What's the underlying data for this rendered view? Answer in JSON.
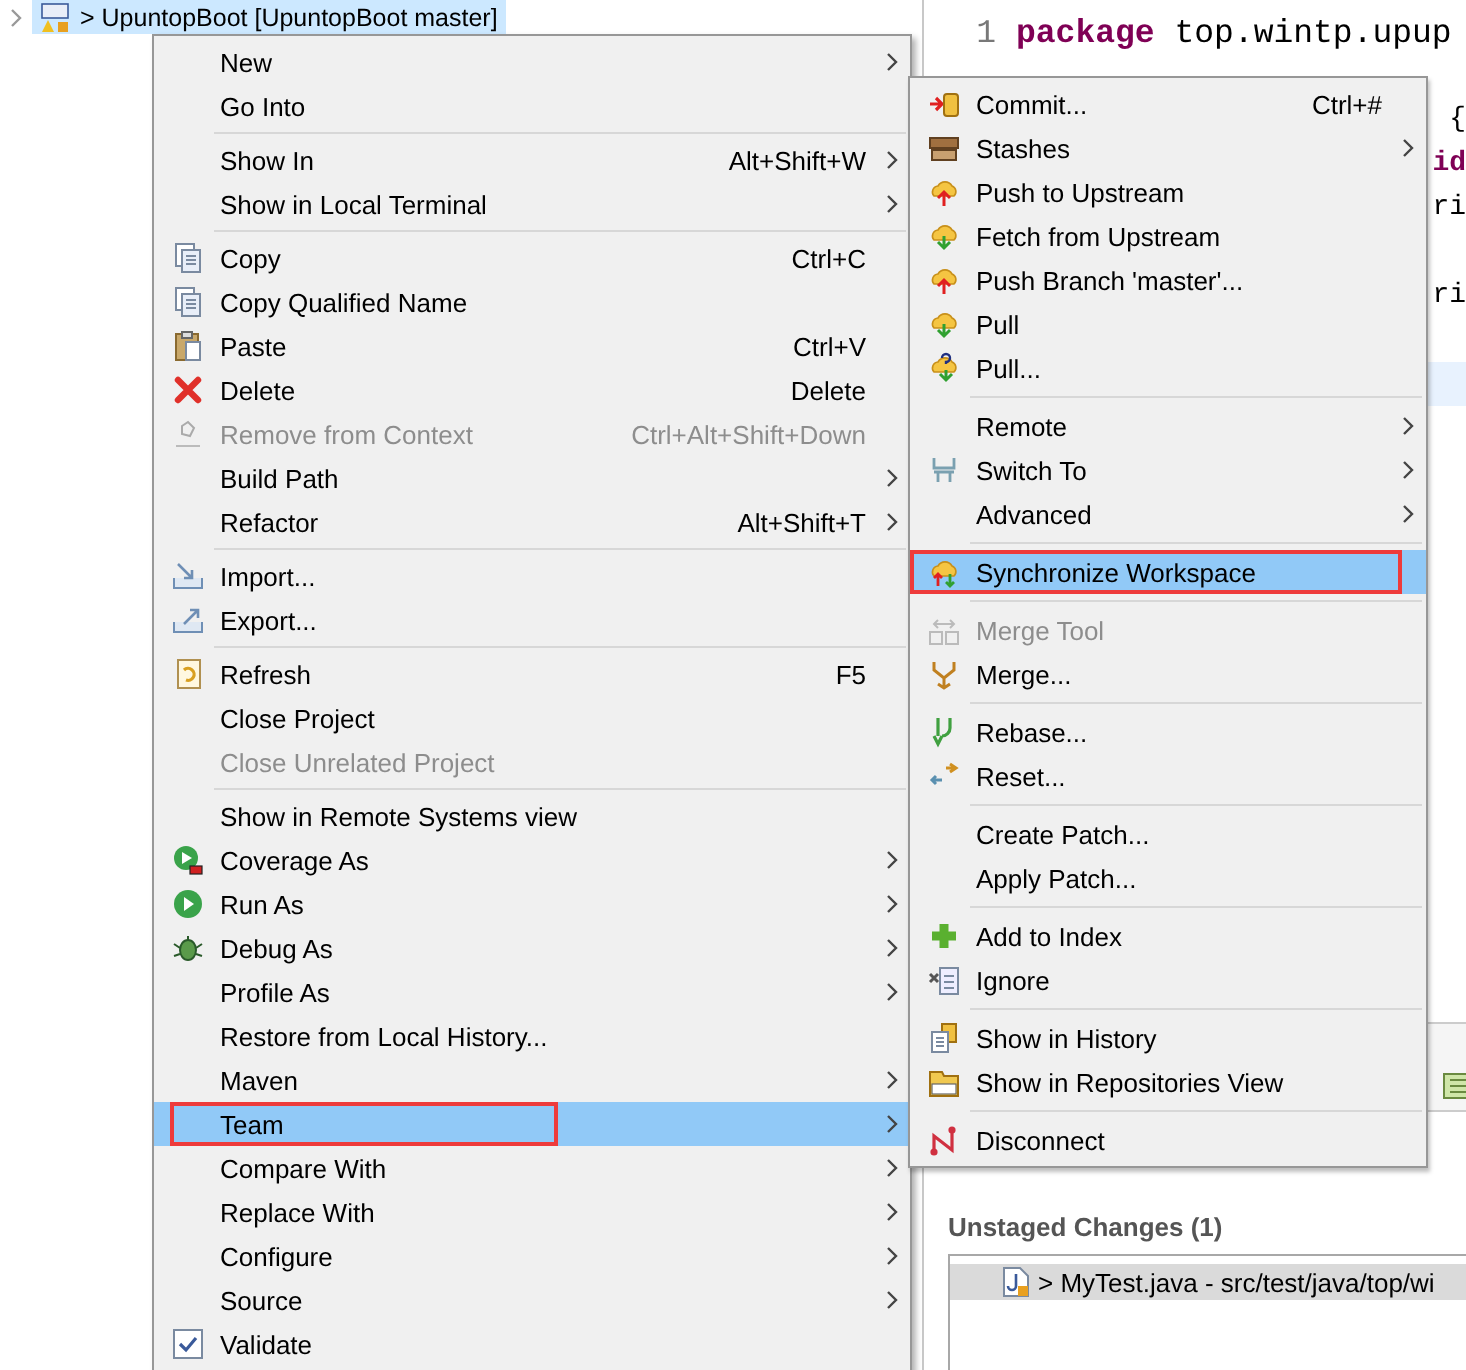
{
  "tree": {
    "label": "> UpuntopBoot [UpuntopBoot master]",
    "selected": true
  },
  "editor": {
    "lines": [
      {
        "number": "1",
        "text": "**package** top.wintp.upup",
        "kind": "full",
        "current": false
      },
      {
        "kind": "full",
        "current": false
      },
      {
        "text": "{",
        "kind": "fragment",
        "current": false
      },
      {
        "text": "id",
        "kind": "keyword",
        "current": false
      },
      {
        "text": "ri",
        "kind": "fragment",
        "current": false
      },
      {
        "kind": "fragment",
        "current": false
      },
      {
        "text": "ri",
        "kind": "fragment",
        "current": false
      },
      {
        "kind": "fragment",
        "current": false
      },
      {
        "kind": "fragment",
        "current": true
      }
    ]
  },
  "staging": {
    "title": "Unstaged Changes (1)",
    "files": [
      {
        "label": "> MyTest.java - src/test/java/top/wi",
        "selected": true
      }
    ]
  },
  "context_menu": {
    "groups": [
      [
        {
          "label": "New",
          "submenu": true,
          "disabled": false,
          "selected": false,
          "outlined": false
        },
        {
          "label": "Go Into",
          "submenu": false,
          "disabled": false,
          "selected": false,
          "outlined": false
        }
      ],
      [
        {
          "label": "Show In",
          "shortcut": "Alt+Shift+W",
          "submenu": true,
          "disabled": false,
          "selected": false,
          "outlined": false
        },
        {
          "label": "Show in Local Terminal",
          "submenu": true,
          "disabled": false,
          "selected": false,
          "outlined": false
        }
      ],
      [
        {
          "label": "Copy",
          "shortcut": "Ctrl+C",
          "submenu": false,
          "disabled": false,
          "selected": false,
          "outlined": false
        },
        {
          "label": "Copy Qualified Name",
          "submenu": false,
          "disabled": false,
          "selected": false,
          "outlined": false
        },
        {
          "label": "Paste",
          "shortcut": "Ctrl+V",
          "submenu": false,
          "disabled": false,
          "selected": false,
          "outlined": false
        },
        {
          "label": "Delete",
          "shortcut": "Delete",
          "submenu": false,
          "disabled": false,
          "selected": false,
          "outlined": false
        },
        {
          "label": "Remove from Context",
          "shortcut": "Ctrl+Alt+Shift+Down",
          "submenu": false,
          "disabled": true,
          "selected": false,
          "outlined": false
        },
        {
          "label": "Build Path",
          "submenu": true,
          "disabled": false,
          "selected": false,
          "outlined": false
        },
        {
          "label": "Refactor",
          "shortcut": "Alt+Shift+T",
          "submenu": true,
          "disabled": false,
          "selected": false,
          "outlined": false
        }
      ],
      [
        {
          "label": "Import...",
          "submenu": false,
          "disabled": false,
          "selected": false,
          "outlined": false
        },
        {
          "label": "Export...",
          "submenu": false,
          "disabled": false,
          "selected": false,
          "outlined": false
        }
      ],
      [
        {
          "label": "Refresh",
          "shortcut": "F5",
          "submenu": false,
          "disabled": false,
          "selected": false,
          "outlined": false
        },
        {
          "label": "Close Project",
          "submenu": false,
          "disabled": false,
          "selected": false,
          "outlined": false
        },
        {
          "label": "Close Unrelated Project",
          "submenu": false,
          "disabled": true,
          "selected": false,
          "outlined": false
        }
      ],
      [
        {
          "label": "Show in Remote Systems view",
          "submenu": false,
          "disabled": false,
          "selected": false,
          "outlined": false
        },
        {
          "label": "Coverage As",
          "submenu": true,
          "disabled": false,
          "selected": false,
          "outlined": false
        },
        {
          "label": "Run As",
          "submenu": true,
          "disabled": false,
          "selected": false,
          "outlined": false
        },
        {
          "label": "Debug As",
          "submenu": true,
          "disabled": false,
          "selected": false,
          "outlined": false
        },
        {
          "label": "Profile As",
          "submenu": true,
          "disabled": false,
          "selected": false,
          "outlined": false
        },
        {
          "label": "Restore from Local History...",
          "submenu": false,
          "disabled": false,
          "selected": false,
          "outlined": false
        },
        {
          "label": "Maven",
          "submenu": true,
          "disabled": false,
          "selected": false,
          "outlined": false
        },
        {
          "label": "Team",
          "submenu": true,
          "disabled": false,
          "selected": true,
          "outlined": true
        },
        {
          "label": "Compare With",
          "submenu": true,
          "disabled": false,
          "selected": false,
          "outlined": false
        },
        {
          "label": "Replace With",
          "submenu": true,
          "disabled": false,
          "selected": false,
          "outlined": false
        },
        {
          "label": "Configure",
          "submenu": true,
          "disabled": false,
          "selected": false,
          "outlined": false
        },
        {
          "label": "Source",
          "submenu": true,
          "disabled": false,
          "selected": false,
          "outlined": false
        },
        {
          "label": "Validate",
          "submenu": false,
          "disabled": false,
          "selected": false,
          "outlined": false
        }
      ]
    ]
  },
  "team_submenu": {
    "groups": [
      [
        {
          "label": "Commit...",
          "shortcut": "Ctrl+#",
          "submenu": false,
          "disabled": false,
          "selected": false,
          "outlined": false
        },
        {
          "label": "Stashes",
          "submenu": true,
          "disabled": false,
          "selected": false,
          "outlined": false
        },
        {
          "label": "Push to Upstream",
          "submenu": false,
          "disabled": false,
          "selected": false,
          "outlined": false
        },
        {
          "label": "Fetch from Upstream",
          "submenu": false,
          "disabled": false,
          "selected": false,
          "outlined": false
        },
        {
          "label": "Push Branch 'master'...",
          "submenu": false,
          "disabled": false,
          "selected": false,
          "outlined": false
        },
        {
          "label": "Pull",
          "submenu": false,
          "disabled": false,
          "selected": false,
          "outlined": false
        },
        {
          "label": "Pull...",
          "submenu": false,
          "disabled": false,
          "selected": false,
          "outlined": false
        }
      ],
      [
        {
          "label": "Remote",
          "submenu": true,
          "disabled": false,
          "selected": false,
          "outlined": false
        },
        {
          "label": "Switch To",
          "submenu": true,
          "disabled": false,
          "selected": false,
          "outlined": false
        },
        {
          "label": "Advanced",
          "submenu": true,
          "disabled": false,
          "selected": false,
          "outlined": false
        }
      ],
      [
        {
          "label": "Synchronize Workspace",
          "submenu": false,
          "disabled": false,
          "selected": true,
          "outlined": true
        }
      ],
      [
        {
          "label": "Merge Tool",
          "submenu": false,
          "disabled": true,
          "selected": false,
          "outlined": false
        },
        {
          "label": "Merge...",
          "submenu": false,
          "disabled": false,
          "selected": false,
          "outlined": false
        }
      ],
      [
        {
          "label": "Rebase...",
          "submenu": false,
          "disabled": false,
          "selected": false,
          "outlined": false
        },
        {
          "label": "Reset...",
          "submenu": false,
          "disabled": false,
          "selected": false,
          "outlined": false
        }
      ],
      [
        {
          "label": "Create Patch...",
          "submenu": false,
          "disabled": false,
          "selected": false,
          "outlined": false
        },
        {
          "label": "Apply Patch...",
          "submenu": false,
          "disabled": false,
          "selected": false,
          "outlined": false
        }
      ],
      [
        {
          "label": "Add to Index",
          "submenu": false,
          "disabled": false,
          "selected": false,
          "outlined": false
        },
        {
          "label": "Ignore",
          "submenu": false,
          "disabled": false,
          "selected": false,
          "outlined": false
        }
      ],
      [
        {
          "label": "Show in History",
          "submenu": false,
          "disabled": false,
          "selected": false,
          "outlined": false
        },
        {
          "label": "Show in Repositories View",
          "submenu": false,
          "disabled": false,
          "selected": false,
          "outlined": false
        }
      ],
      [
        {
          "label": "Disconnect",
          "submenu": false,
          "disabled": false,
          "selected": false,
          "outlined": false
        }
      ]
    ]
  }
}
